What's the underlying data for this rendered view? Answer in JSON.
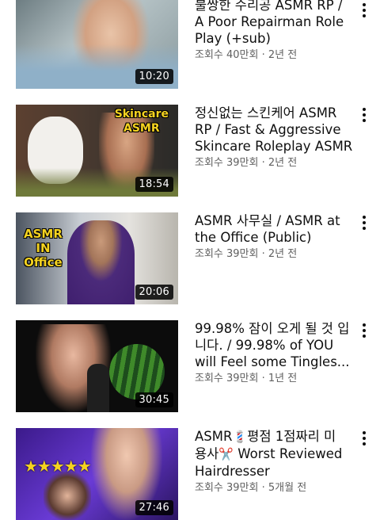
{
  "videos": [
    {
      "title": "불쌍한 수리공 ASMR RP /\nA Poor Repairman Role\nPlay (+sub)",
      "views": "조회수 40만회",
      "age": "2년 전",
      "duration": "10:20",
      "badge": ""
    },
    {
      "title": "정신없는 스킨케어 ASMR\nRP / Fast & Aggressive\nSkincare Roleplay ASMR",
      "views": "조회수 39만회",
      "age": "2년 전",
      "duration": "18:54",
      "badge_line1": "Skincare",
      "badge_line2": "ASMR"
    },
    {
      "title": "ASMR 사무실 / ASMR at\nthe Office (Public)",
      "views": "조회수 39만회",
      "age": "2년 전",
      "duration": "20:06",
      "badge_line1": "ASMR",
      "badge_line2": "IN",
      "badge_line3": "Office"
    },
    {
      "title": "99.98% 잠이 오게 될 것 입\n니다. / 99.98% of YOU\nwill Feel some Tingles...",
      "views": "조회수 39만회",
      "age": "1년 전",
      "duration": "30:45"
    },
    {
      "title_part1": "ASMR",
      "title_emoji1": "💈",
      "title_part2": "평점 1점짜리 미\n용사",
      "title_emoji2": "✂️",
      "title_part3": " Worst Reviewed\nHairdresser",
      "views": "조회수 39만회",
      "age": "5개월 전",
      "duration": "27:46",
      "stars": "★★★★★"
    }
  ],
  "separator": " · ",
  "colors": {
    "meta": "#606060",
    "title": "#0f0f0f",
    "badge_yellow": "#f5d320"
  }
}
